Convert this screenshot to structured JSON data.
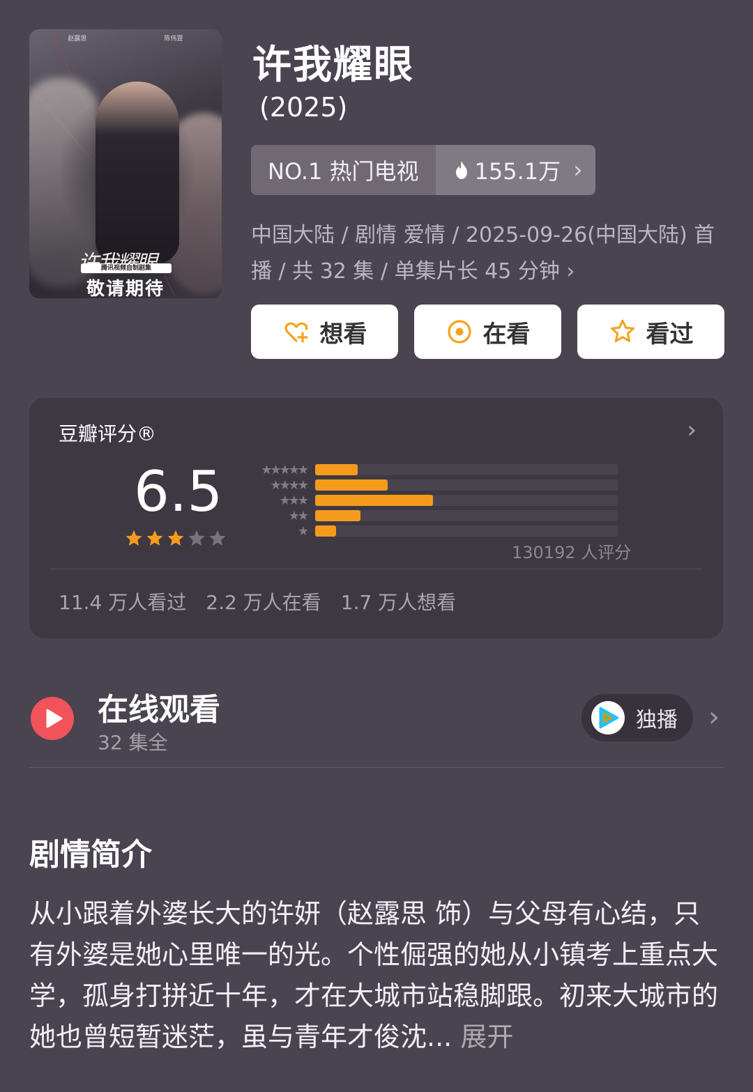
{
  "poster": {
    "cast_left": "赵露思",
    "cast_right": "陈伟霆",
    "calligraphy": "许我耀眼",
    "badge": "腾讯视频自制剧集",
    "coming_soon": "敬请期待"
  },
  "title": "许我耀眼",
  "year": "(2025)",
  "rank": {
    "label": "NO.1 热门电视",
    "heat": "155.1万",
    "heat_icon": "flame-icon"
  },
  "meta": "中国大陆 / 剧情 爱情 / 2025-09-26(中国大陆) 首播 / 共 32 集 / 单集片长 45 分钟",
  "actions": {
    "want": "想看",
    "watching": "在看",
    "watched": "看过"
  },
  "rating": {
    "header": "豆瓣评分®",
    "score": "6.5",
    "stars_filled": 3,
    "stars_total": 5,
    "distribution": [
      {
        "stars": "★★★★★",
        "fraction": 0.14
      },
      {
        "stars": "★★★★",
        "fraction": 0.24
      },
      {
        "stars": "★★★",
        "fraction": 0.39
      },
      {
        "stars": "★★",
        "fraction": 0.15
      },
      {
        "stars": "★",
        "fraction": 0.07
      }
    ],
    "count": "130192 人评分",
    "watched": "11.4 万人看过",
    "watching": "2.2 万人在看",
    "want": "1.7 万人想看"
  },
  "online": {
    "title": "在线观看",
    "episodes": "32 集全",
    "exclusive": "独播"
  },
  "synopsis": {
    "title": "剧情简介",
    "text": "从小跟着外婆长大的许妍（赵露思 饰）与父母有心结，只有外婆是她心里唯一的光。个性倔强的她从小镇考上重点大学，孤身打拼近十年，才在大城市站稳脚跟。初来大城市的她也曾短暂迷茫，虽与青年才俊沈...",
    "expand": "展开"
  },
  "colors": {
    "background": "#4a4350",
    "accent": "#f59b1c",
    "play": "#f0535a"
  }
}
